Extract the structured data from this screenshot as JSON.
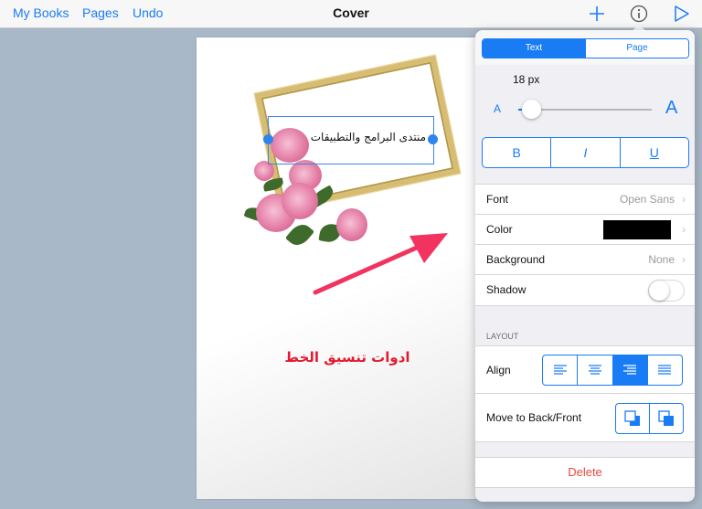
{
  "toolbar": {
    "my_books": "My Books",
    "pages": "Pages",
    "undo": "Undo",
    "title": "Cover"
  },
  "canvas": {
    "selected_text": "منتدى البرامج والتطبيقات",
    "caption": "ادوات تنسيق الخط"
  },
  "inspector": {
    "tabs": [
      {
        "label": "Text",
        "selected": true
      },
      {
        "label": "Page",
        "selected": false
      }
    ],
    "font_size": "18 px",
    "size_small_label": "A",
    "size_large_label": "A",
    "slider_level": 0.1,
    "style_buttons": {
      "bold": "B",
      "italic": "I",
      "underline": "U"
    },
    "font_label": "Font",
    "font_value": "Open Sans",
    "color_label": "Color",
    "color_value": "#000000",
    "background_label": "Background",
    "background_value": "None",
    "shadow_label": "Shadow",
    "shadow_on": false,
    "layout_header": "LAYOUT",
    "align_label": "Align",
    "align_selected": "right",
    "move_label": "Move to Back/Front",
    "delete_label": "Delete"
  },
  "colors": {
    "accent": "#1a7cf5",
    "delete": "#e8473c",
    "caption": "#e31b2f",
    "arrow": "#f2325f"
  }
}
